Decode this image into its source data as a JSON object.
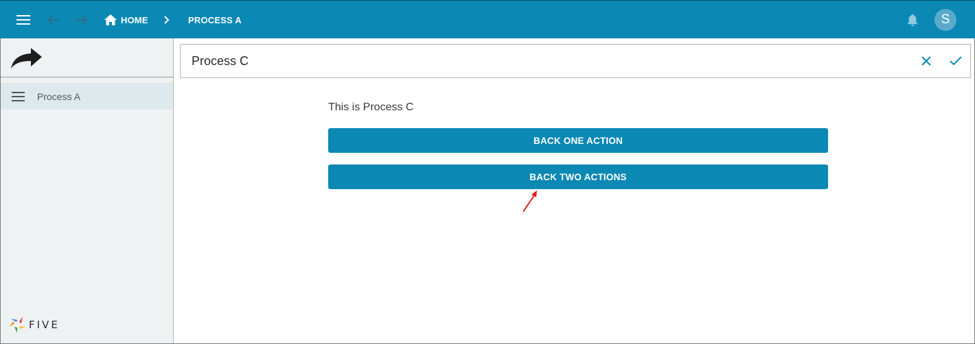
{
  "topbar": {
    "breadcrumbs": [
      {
        "label": "HOME",
        "icon": "home-icon"
      },
      {
        "label": "PROCESS A"
      }
    ],
    "separator_icon": "chevron-right-icon",
    "avatar_initial": "S",
    "colors": {
      "bar": "#0b88b4",
      "avatar": "#5aabcb"
    }
  },
  "sidebar": {
    "header_icon": "share-arrow-icon",
    "items": [
      {
        "label": "Process A",
        "icon": "menu-icon",
        "selected": true
      }
    ],
    "brand": "FIVE"
  },
  "form": {
    "title": "Process C",
    "cancel_icon": "close-icon",
    "confirm_icon": "check-icon",
    "body_text": "This is Process C",
    "buttons": [
      {
        "label": "BACK ONE ACTION"
      },
      {
        "label": "BACK TWO ACTIONS"
      }
    ]
  }
}
